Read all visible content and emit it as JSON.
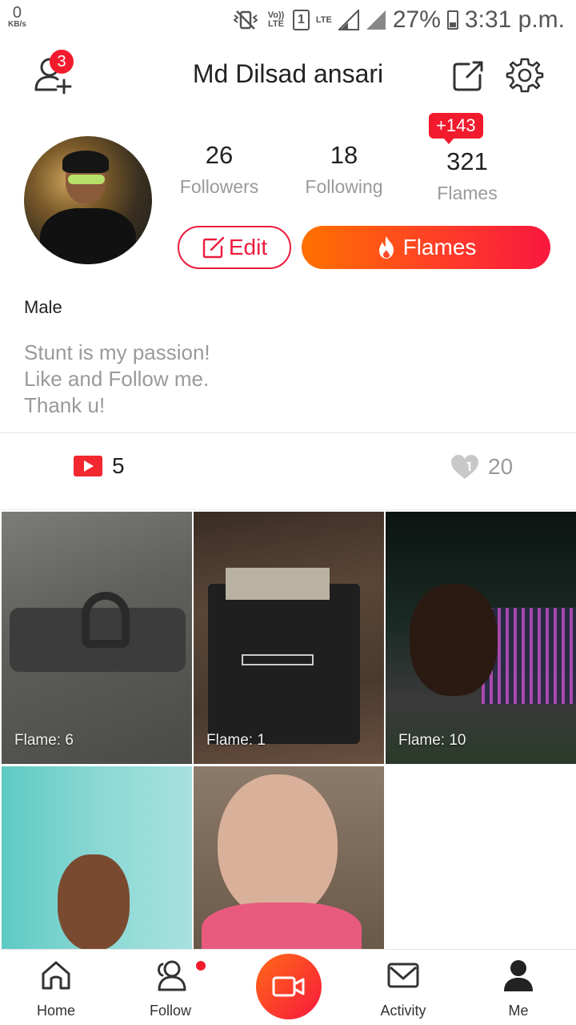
{
  "status_bar": {
    "kbs_value": "0",
    "kbs_unit": "KB/s",
    "volte": "Vo)) LTE",
    "sim": "1",
    "lte": "LTE",
    "battery": "27%",
    "time": "3:31 p.m."
  },
  "header": {
    "title": "Md Dilsad ansari",
    "notification_count": "3",
    "icons": [
      "add-user-icon",
      "share-icon",
      "gear-icon"
    ]
  },
  "profile": {
    "followers_count": "26",
    "followers_label": "Followers",
    "following_count": "18",
    "following_label": "Following",
    "flames_count": "321",
    "flames_label": "Flames",
    "flames_delta": "+143",
    "edit_label": "Edit",
    "flames_button_label": "Flames",
    "gender": "Male",
    "bio": [
      "Stunt is my passion!",
      "Like and Follow me.",
      "Thank u!"
    ]
  },
  "summary": {
    "video_count": "5",
    "like_count": "20"
  },
  "videos": [
    {
      "flame": "Flame: 6"
    },
    {
      "flame": "Flame: 1"
    },
    {
      "flame": "Flame: 10"
    },
    {
      "flame": ""
    },
    {
      "flame": ""
    }
  ],
  "nav": {
    "home": "Home",
    "follow": "Follow",
    "activity": "Activity",
    "me": "Me"
  },
  "colors": {
    "accent": "#f8183e",
    "accent_orange": "#ff7100",
    "badge": "#f21b2d",
    "muted_text": "#9a9a9a"
  }
}
